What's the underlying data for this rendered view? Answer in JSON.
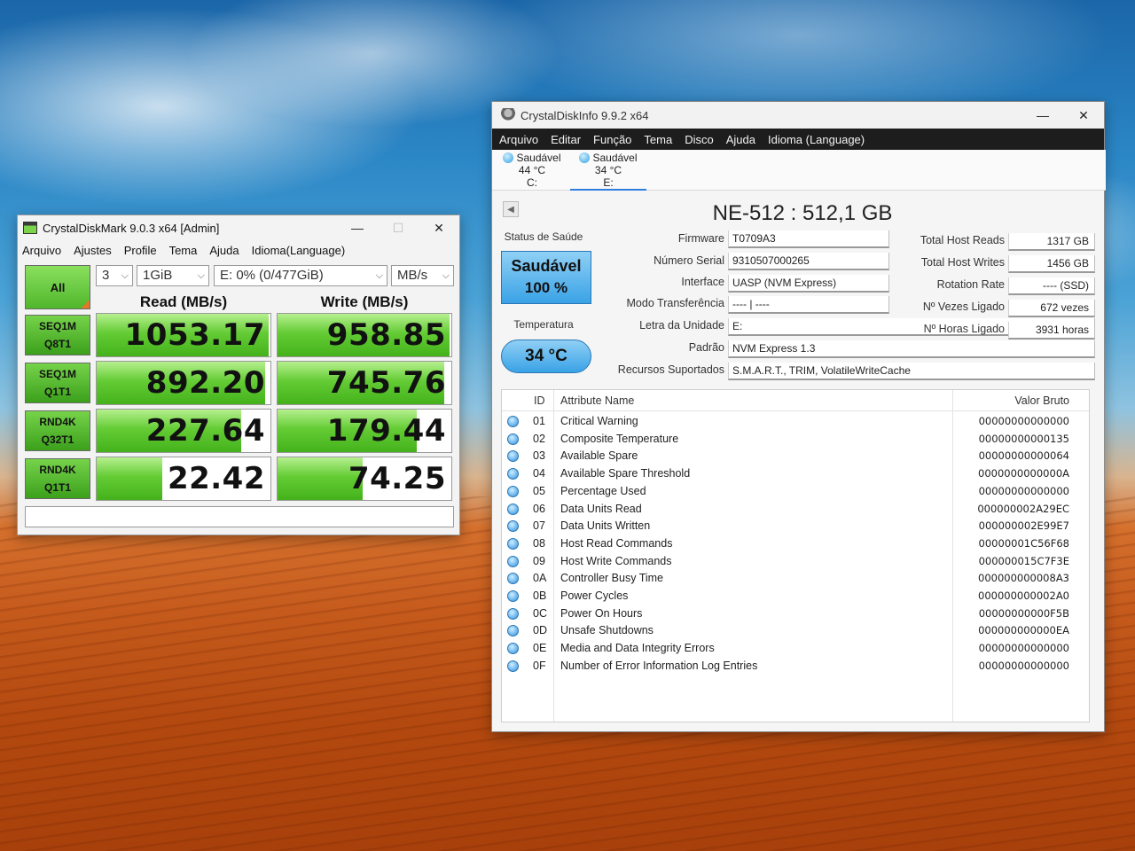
{
  "cdm": {
    "title": "CrystalDiskMark 9.0.3 x64 [Admin]",
    "menu": [
      "Arquivo",
      "Ajustes",
      "Profile",
      "Tema",
      "Ajuda",
      "Idioma(Language)"
    ],
    "all_label": "All",
    "count": "3",
    "size": "1GiB",
    "drive": "E: 0% (0/477GiB)",
    "unit": "MB/s",
    "read_header": "Read (MB/s)",
    "write_header": "Write (MB/s)",
    "rows": [
      {
        "l1": "SEQ1M",
        "l2": "Q8T1",
        "read": "1053.17",
        "write": "958.85",
        "read_frac": 0.99,
        "write_frac": 0.99
      },
      {
        "l1": "SEQ1M",
        "l2": "Q1T1",
        "read": "892.20",
        "write": "745.76",
        "read_frac": 0.97,
        "write_frac": 0.96
      },
      {
        "l1": "RND4K",
        "l2": "Q32T1",
        "read": "227.64",
        "write": "179.44",
        "read_frac": 0.83,
        "write_frac": 0.8
      },
      {
        "l1": "RND4K",
        "l2": "Q1T1",
        "read": "22.42",
        "write": "74.25",
        "read_frac": 0.38,
        "write_frac": 0.49
      }
    ]
  },
  "cdi": {
    "title": "CrystalDiskInfo 9.9.2 x64",
    "menu": [
      "Arquivo",
      "Editar",
      "Função",
      "Tema",
      "Disco",
      "Ajuda",
      "Idioma (Language)"
    ],
    "disks": [
      {
        "status": "Saudável",
        "temp": "44 °C",
        "letter": "C:"
      },
      {
        "status": "Saudável",
        "temp": "34 °C",
        "letter": "E:"
      }
    ],
    "model": "NE-512 : 512,1 GB",
    "health_label": "Status de Saúde",
    "health_status": "Saudável",
    "health_pct": "100 %",
    "temp_label": "Temperatura",
    "temp_value": "34 °C",
    "fields": [
      {
        "label": "Firmware",
        "value": "T0709A3"
      },
      {
        "label": "Número Serial",
        "value": "9310507000265"
      },
      {
        "label": "Interface",
        "value": "UASP (NVM Express)"
      },
      {
        "label": "Modo Transferência",
        "value": "---- | ----"
      },
      {
        "label": "Letra da Unidade",
        "value": "E:"
      },
      {
        "label": "Padrão",
        "value": "NVM Express 1.3"
      },
      {
        "label": "Recursos Suportados",
        "value": "S.M.A.R.T., TRIM, VolatileWriteCache"
      }
    ],
    "right_fields": [
      {
        "label": "Total Host Reads",
        "value": "1317 GB"
      },
      {
        "label": "Total Host Writes",
        "value": "1456 GB"
      },
      {
        "label": "Rotation Rate",
        "value": "---- (SSD)"
      },
      {
        "label": "Nº Vezes Ligado",
        "value": "672 vezes"
      },
      {
        "label": "Nº Horas Ligado",
        "value": "3931 horas"
      }
    ],
    "smart_headers": {
      "id": "ID",
      "name": "Attribute Name",
      "raw": "Valor Bruto"
    },
    "smart": [
      {
        "id": "01",
        "name": "Critical Warning",
        "raw": "00000000000000"
      },
      {
        "id": "02",
        "name": "Composite Temperature",
        "raw": "00000000000135"
      },
      {
        "id": "03",
        "name": "Available Spare",
        "raw": "00000000000064"
      },
      {
        "id": "04",
        "name": "Available Spare Threshold",
        "raw": "0000000000000A"
      },
      {
        "id": "05",
        "name": "Percentage Used",
        "raw": "00000000000000"
      },
      {
        "id": "06",
        "name": "Data Units Read",
        "raw": "000000002A29EC"
      },
      {
        "id": "07",
        "name": "Data Units Written",
        "raw": "000000002E99E7"
      },
      {
        "id": "08",
        "name": "Host Read Commands",
        "raw": "00000001C56F68"
      },
      {
        "id": "09",
        "name": "Host Write Commands",
        "raw": "000000015C7F3E"
      },
      {
        "id": "0A",
        "name": "Controller Busy Time",
        "raw": "000000000008A3"
      },
      {
        "id": "0B",
        "name": "Power Cycles",
        "raw": "000000000002A0"
      },
      {
        "id": "0C",
        "name": "Power On Hours",
        "raw": "00000000000F5B"
      },
      {
        "id": "0D",
        "name": "Unsafe Shutdowns",
        "raw": "000000000000EA"
      },
      {
        "id": "0E",
        "name": "Media and Data Integrity Errors",
        "raw": "00000000000000"
      },
      {
        "id": "0F",
        "name": "Number of Error Information Log Entries",
        "raw": "00000000000000"
      }
    ]
  }
}
